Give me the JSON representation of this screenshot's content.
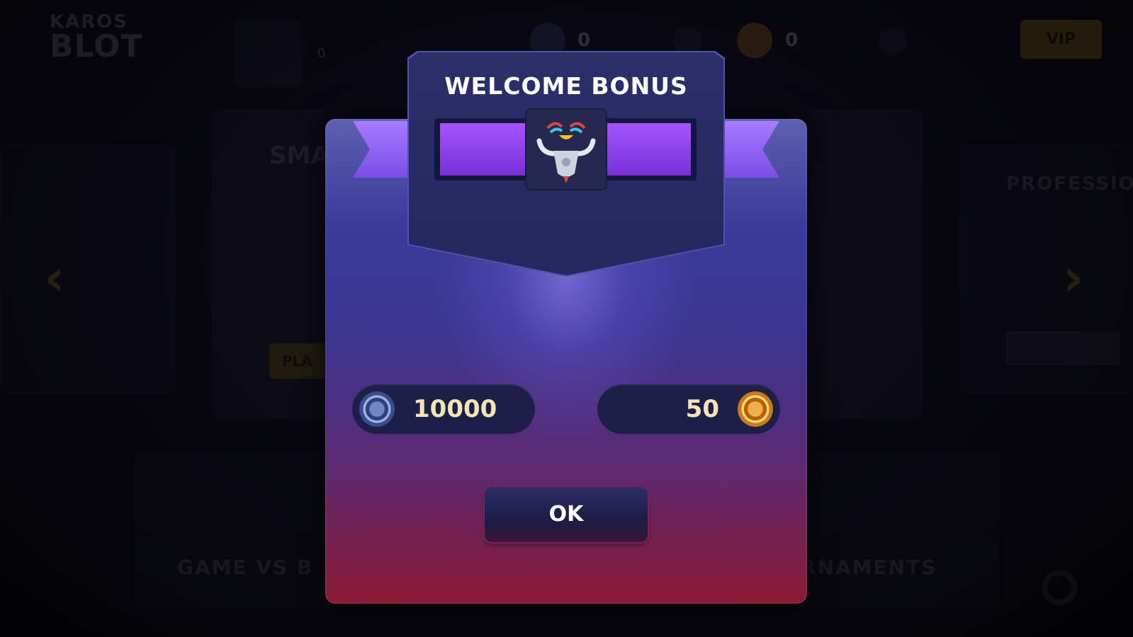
{
  "background": {
    "logo": {
      "line1": "KAROS",
      "line2": "BLOT"
    },
    "hud": {
      "player_name": "",
      "player_level": "0",
      "blue_chips": "0",
      "gold_chips": "0",
      "vip_label": "VIP"
    },
    "cards": {
      "left_title": "SMA",
      "right_title": "PROFESSIO",
      "left_play": "PLA",
      "bottom_left": "GAME VS B",
      "bottom_right": "RNAMENTS"
    }
  },
  "modal": {
    "title": "WELCOME BONUS",
    "mascot_icon": "bull-mascot-icon",
    "rewards": {
      "blue_chips": "10000",
      "gold_chips": "50"
    },
    "ok_label": "OK"
  },
  "colors": {
    "ribbon_purple": "#8a3cf0",
    "banner_navy": "#2c2f6a",
    "modal_top": "#5d5fb0",
    "modal_bottom": "#8a1a34",
    "gold_text": "#f2e4b4"
  }
}
